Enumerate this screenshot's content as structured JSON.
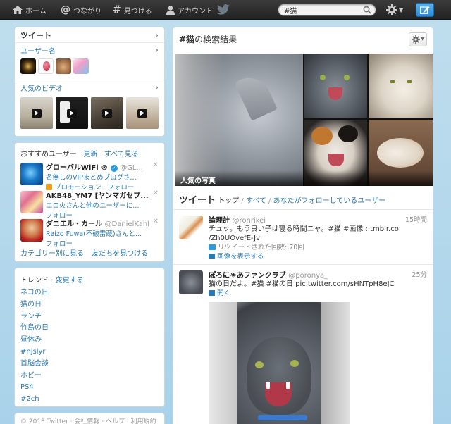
{
  "topbar": {
    "home": "ホーム",
    "connect": "つながり",
    "discover": "見つける",
    "account": "アカウント",
    "search_value": "#猫"
  },
  "sidebar": {
    "tweet_label": "ツイート",
    "users_label": "ユーザー名",
    "videos_label": "人気のビデオ"
  },
  "wtf": {
    "title": "おすすめユーザー",
    "refresh": "更新",
    "view_all": "すべて見る",
    "users": [
      {
        "name": "グローバルWiFi ®",
        "handle": "@GL...",
        "line2": "名無しのVIPまとめブログさ...",
        "line3": "プロモーション · フォロー"
      },
      {
        "name": "AKB48_YM7 [ヤンマガセブ...",
        "handle": "",
        "line2": "エロ火さんと他のユーザーに...",
        "line3": "フォロー"
      },
      {
        "name": "ダニエル・カール",
        "handle": "@DanielKahl",
        "line2": "Raizo Fuwa(不破雷蔵)さんと...",
        "line3": "フォロー"
      }
    ],
    "footer_left": "カテゴリー別に見る",
    "footer_right": "友だちを見つける"
  },
  "trends": {
    "title": "トレンド",
    "change": "変更する",
    "items": [
      "ネコの日",
      "猫の日",
      "ランチ",
      "竹島の日",
      "昼休み",
      "#njslyr",
      "首脳会談",
      "ホビー",
      "PS4",
      "#2ch"
    ]
  },
  "footer": {
    "text": "© 2013 Twitter · 会社情報 · ヘルプ · 利用規約"
  },
  "main": {
    "title_hash": "#猫",
    "title_rest": "の検索結果",
    "photos_caption": "人気の写真",
    "tabs": {
      "tweets": "ツイート",
      "top": "トップ",
      "all": "すべて",
      "following": "あなたがフォローしているユーザー"
    },
    "tweets": [
      {
        "name": "論理計",
        "handle": "@ronrikei",
        "time": "15時間",
        "text1": "チュッ。もう良い子は寝る時間ニャ。#猫 #画像 : tmblr.co",
        "text2": "/Zh0UOvefE-Jv",
        "meta": "リツイートされた回数: 70回",
        "action": "画像を表示する"
      },
      {
        "name": "ぽろにゃあファンクラブ",
        "handle": "@poronya_",
        "time": "25分",
        "text1": "猫の日だよ。#猫 #猫の日 pic.twitter.com/sHNTpH8eJC",
        "action": "開く"
      }
    ]
  },
  "colors": {
    "link": "#2a7ab0",
    "topbar": "#2b2b2b",
    "compose": "#3a96dd",
    "background": "#c0deed"
  }
}
